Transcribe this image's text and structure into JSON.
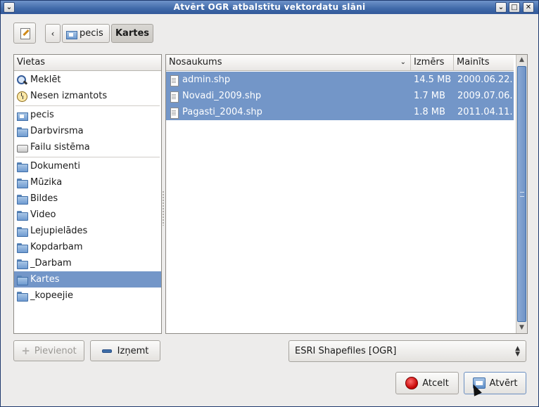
{
  "window": {
    "title": "Atvērt OGR atbalstītu vektordatu slāni",
    "menu_glyph": "⌄",
    "min_glyph": "⌄",
    "max_glyph": "□",
    "close_glyph": "✕"
  },
  "pathbar": {
    "back_glyph": "‹",
    "crumbs": [
      "pecis",
      "Kartes"
    ]
  },
  "places": {
    "header": "Vietas",
    "items": [
      {
        "label": "Meklēt",
        "icon": "search-icon"
      },
      {
        "label": "Nesen izmantots",
        "icon": "recent-icon"
      },
      {
        "label": "pecis",
        "icon": "home-folder-icon"
      },
      {
        "label": "Darbvirsma",
        "icon": "desktop-folder-icon"
      },
      {
        "label": "Failu sistēma",
        "icon": "drive-icon"
      },
      {
        "label": "Dokumenti",
        "icon": "documents-folder-icon"
      },
      {
        "label": "Mūzika",
        "icon": "music-folder-icon"
      },
      {
        "label": "Bildes",
        "icon": "pictures-folder-icon"
      },
      {
        "label": "Video",
        "icon": "video-folder-icon"
      },
      {
        "label": "Lejupielādes",
        "icon": "downloads-folder-icon"
      },
      {
        "label": "Kopdarbam",
        "icon": "folder-icon"
      },
      {
        "label": "_Darbam",
        "icon": "folder-icon"
      },
      {
        "label": "Kartes",
        "icon": "folder-icon",
        "selected": true
      },
      {
        "label": "_kopeejie",
        "icon": "folder-icon"
      }
    ]
  },
  "files": {
    "columns": {
      "name": "Nosaukums",
      "size": "Izmērs",
      "modified": "Mainīts"
    },
    "sort_glyph": "⌄",
    "rows": [
      {
        "name": "admin.shp",
        "size": "14.5 MB",
        "modified": "2000.06.22."
      },
      {
        "name": "Novadi_2009.shp",
        "size": "1.7 MB",
        "modified": "2009.07.06."
      },
      {
        "name": "Pagasti_2004.shp",
        "size": "1.8 MB",
        "modified": "2011.04.11."
      }
    ]
  },
  "buttons": {
    "add": "Pievienot",
    "remove": "Izņemt",
    "cancel": "Atcelt",
    "open": "Atvērt"
  },
  "filter": {
    "selected": "ESRI Shapefiles [OGR]"
  },
  "colors": {
    "selection": "#7396c8",
    "titlebar": "#3f69a8"
  }
}
